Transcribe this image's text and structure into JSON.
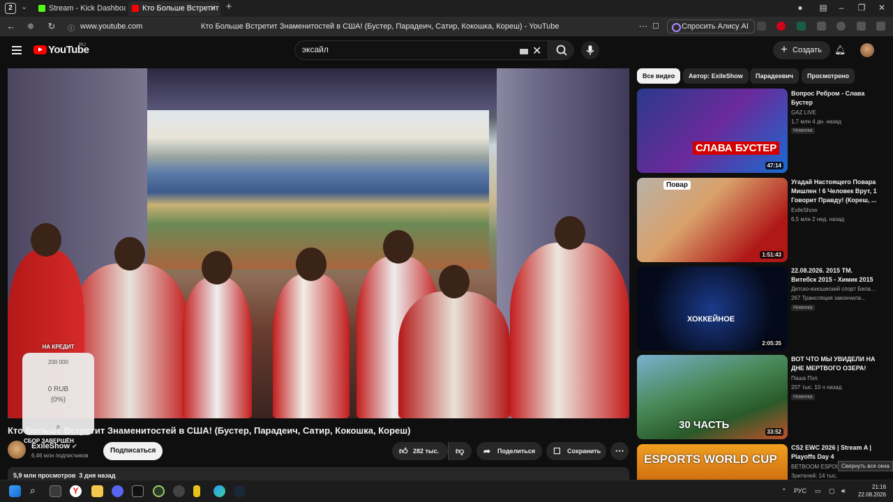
{
  "browser": {
    "tab_count": "2",
    "tabs": [
      {
        "label": "Stream - Kick Dashboard",
        "color": "#53fc18"
      },
      {
        "label": "Кто Больше Встретит",
        "color": "#ff0000"
      }
    ],
    "url": "www.youtube.com",
    "page_title": "Кто Больше Встретит Знаменитостей в США! (Бустер, Парадеич, Сатир, Кокошка, Кореш) - YouTube",
    "alice_label": "Спросить Алису AI"
  },
  "youtube": {
    "logo_text": "YouTube",
    "logo_region": "RU",
    "search_value": "эксайл",
    "create_label": "Создать"
  },
  "overlay": {
    "heading": "НА КРЕДИТ",
    "goal": "200 000",
    "amount": "0 RUB",
    "percent": "(0%)",
    "zero": "0",
    "footer": "СБОР ЗАВЕРШЁН"
  },
  "video": {
    "title": "Кто Больше Встретит Знаменитостей в США! (Бустер, Парадеич, Сатир, Кокошка, Кореш)",
    "channel": "ExileShow",
    "subscribers": "6,46 млн подписчиков",
    "subscribe_label": "Подписаться",
    "likes": "282 тыс.",
    "share_label": "Поделиться",
    "save_label": "Сохранить",
    "views": "5,9 млн просмотров",
    "date": "3 дня назад"
  },
  "filters": [
    "Все видео",
    "Автор: ExileShow",
    "Парадеевич",
    "Просмотрено"
  ],
  "recommendations": [
    {
      "title": "Вопрос Ребром - Слава Бустер",
      "channel": "GAZ LIVE",
      "meta": "1,7 млн   4 дн. назад",
      "badge": "Новинка",
      "duration": "47:14",
      "thumb_text": "СЛАВА БУСТЕР"
    },
    {
      "title": "Угадай Настоящего Повара Мишлен ! 6 Человек Врут, 1 Говорит Правду! (Кореш, ...",
      "channel": "ExileShow",
      "meta": "6,5 млн   2 нед. назад",
      "badge": "",
      "duration": "1:51:43",
      "thumb_text": "Повар"
    },
    {
      "title": "22.08.2026. 2015 ТМ. Витебск 2015 - Химик 2015",
      "channel": "Детско-юношеский спорт Бела...",
      "meta": "267   Трансляция закончила...",
      "badge": "Новинка",
      "duration": "2:05:35",
      "thumb_text": "ХОККЕЙНОЕ"
    },
    {
      "title": "ВОТ ЧТО МЫ УВИДЕЛИ НА ДНЕ МЕРТВОГО ОЗЕРА!",
      "channel": "Паша Пэл",
      "meta": "207 тыс.   10 ч назад",
      "badge": "Новинка",
      "duration": "33:52",
      "thumb_text": "30 ЧАСТЬ"
    },
    {
      "title": "CS2 EWC 2026 | Stream A | Playoffs Day 4",
      "channel": "BETBOOM ESPOR...",
      "meta": "Зрителей: 14 тыс.",
      "badge": "",
      "duration": "",
      "thumb_text": "ESPORTS WORLD CUP"
    }
  ],
  "taskbar": {
    "tooltip": "Свернуть все окна",
    "lang": "РУС",
    "time": "21:16",
    "date": "22.08.2026"
  }
}
